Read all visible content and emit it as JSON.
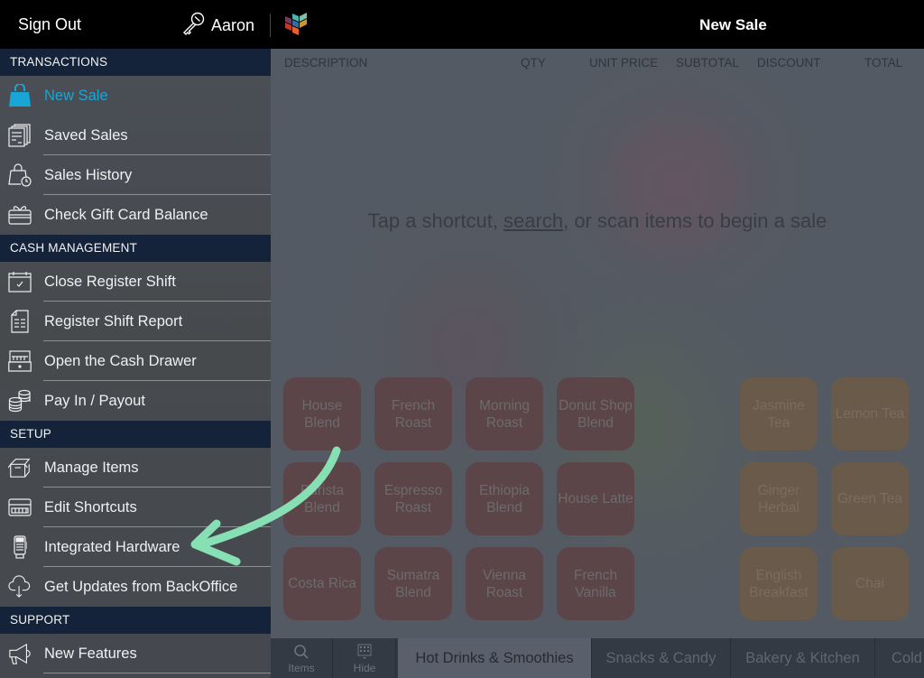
{
  "topbar": {
    "sign_out": "Sign Out",
    "user_name": "Aaron",
    "user_icon": "key-icon",
    "page_title": "New Sale",
    "logo_colors": [
      "#7b3a5a",
      "#4bb3ad",
      "#2d6fa6",
      "#d0952c",
      "#c0392b",
      "#e6602c",
      "#a0314c"
    ]
  },
  "sidebar": {
    "sections": [
      {
        "title": "TRANSACTIONS",
        "items": [
          {
            "label": "New Sale",
            "icon": "shopping-bag-icon",
            "active": true
          },
          {
            "label": "Saved Sales",
            "icon": "saved-documents-icon"
          },
          {
            "label": "Sales History",
            "icon": "bag-clock-icon"
          },
          {
            "label": "Check Gift Card Balance",
            "icon": "gift-card-icon"
          }
        ]
      },
      {
        "title": "CASH MANAGEMENT",
        "items": [
          {
            "label": "Close Register Shift",
            "icon": "calendar-check-icon"
          },
          {
            "label": "Register Shift Report",
            "icon": "report-icon"
          },
          {
            "label": "Open the Cash Drawer",
            "icon": "cash-drawer-icon"
          },
          {
            "label": "Pay In / Payout",
            "icon": "coins-icon"
          }
        ]
      },
      {
        "title": "SETUP",
        "items": [
          {
            "label": "Manage Items",
            "icon": "box-icon"
          },
          {
            "label": "Edit Shortcuts",
            "icon": "keyboard-icon"
          },
          {
            "label": "Integrated Hardware",
            "icon": "card-terminal-icon"
          },
          {
            "label": "Get Updates from BackOffice",
            "icon": "cloud-download-icon"
          }
        ]
      },
      {
        "title": "SUPPORT",
        "items": [
          {
            "label": "New Features",
            "icon": "megaphone-icon"
          }
        ]
      }
    ],
    "active_color": "#18a6d6"
  },
  "main": {
    "columns": [
      "DESCRIPTION",
      "QTY",
      "UNIT PRICE",
      "SUBTOTAL",
      "DISCOUNT",
      "TOTAL"
    ],
    "empty_message": {
      "before": "Tap a shortcut, ",
      "link": "search",
      "after": ", or scan items to begin a sale"
    },
    "coffee_shortcuts": [
      "House Blend",
      "French Roast",
      "Morning Roast",
      "Donut Shop Blend",
      "Barista Blend",
      "Espresso Roast",
      "Ethiopia Blend",
      "House Latte",
      "Costa Rica",
      "Sumatra Blend",
      "Vienna Roast",
      "French Vanilla"
    ],
    "tea_shortcuts": [
      "Jasmine Tea",
      "Lemon Tea",
      "Ginger Herbal",
      "Green Tea",
      "English Breakfast",
      "Chai"
    ]
  },
  "tabbar": {
    "tools": [
      {
        "label": "Items",
        "icon": "search-icon"
      },
      {
        "label": "Hide",
        "icon": "grid-icon"
      }
    ],
    "tabs": [
      {
        "label": "Hot Drinks & Smoothies",
        "active": true
      },
      {
        "label": "Snacks & Candy"
      },
      {
        "label": "Bakery & Kitchen"
      },
      {
        "label": "Cold"
      }
    ]
  },
  "annotation": {
    "type": "hand-drawn arrow",
    "points_to": "Integrated Hardware",
    "color": "#86e0b3"
  }
}
